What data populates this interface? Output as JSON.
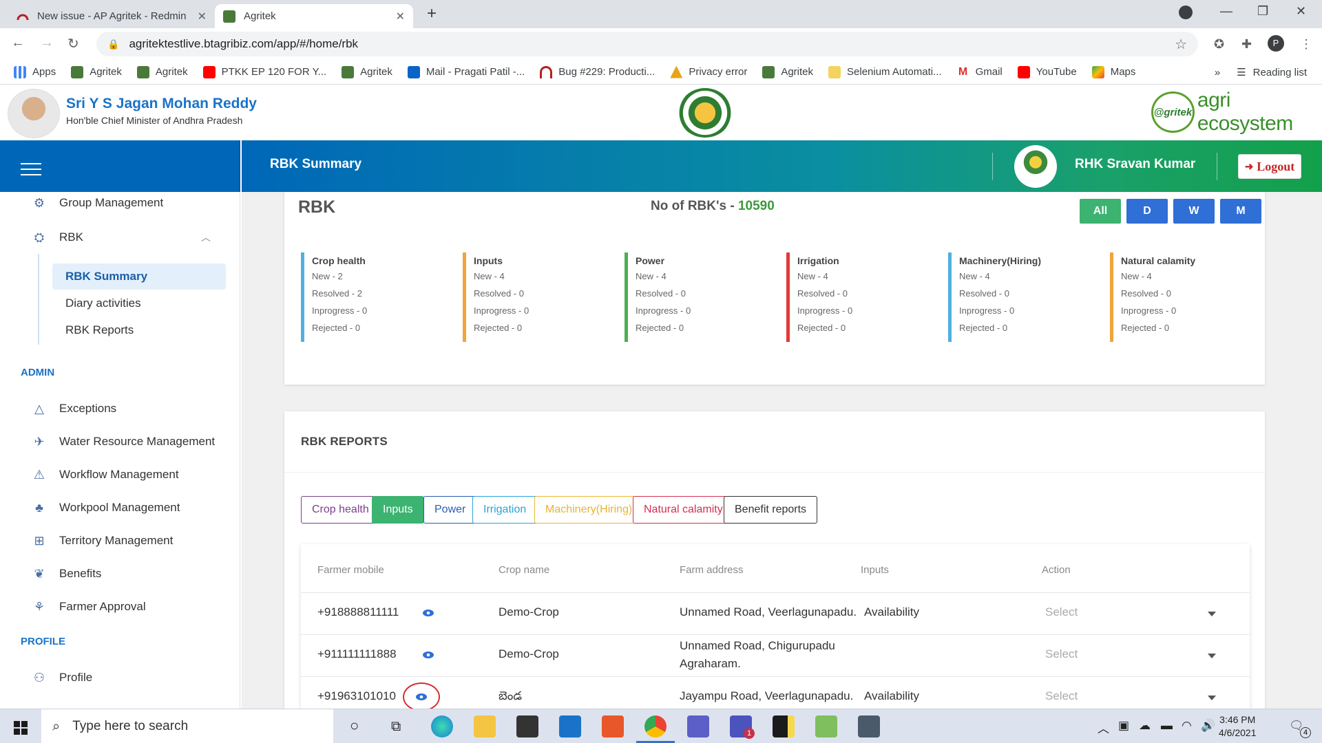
{
  "browser": {
    "tabs": [
      {
        "title": "New issue - AP Agritek - Redmin",
        "active": false
      },
      {
        "title": "Agritek",
        "active": true
      }
    ],
    "url": "agritektestlive.btagribiz.com/app/#/home/rbk",
    "profile_initial": "P",
    "bookmarks": [
      {
        "label": "Apps",
        "icon": "apps-grid-icon",
        "color": "#4285f4"
      },
      {
        "label": "Agritek",
        "icon": "agritek-icon",
        "color": "#4a7a3a"
      },
      {
        "label": "Agritek",
        "icon": "agritek-icon",
        "color": "#4a7a3a"
      },
      {
        "label": "PTKK EP 120 FOR Y...",
        "icon": "youtube-icon",
        "color": "#ff0000"
      },
      {
        "label": "Agritek",
        "icon": "agritek-icon",
        "color": "#4a7a3a"
      },
      {
        "label": "Mail - Pragati Patil -...",
        "icon": "outlook-icon",
        "color": "#0a64c8"
      },
      {
        "label": "Bug #229: Producti...",
        "icon": "redmine-icon",
        "color": "#b32020"
      },
      {
        "label": "Privacy error",
        "icon": "warning-icon",
        "color": "#e8a317"
      },
      {
        "label": "Agritek",
        "icon": "agritek-icon",
        "color": "#4a7a3a"
      },
      {
        "label": "Selenium Automati...",
        "icon": "folder-icon",
        "color": "#f4d35e"
      },
      {
        "label": "Gmail",
        "icon": "gmail-icon",
        "color": "#d93025"
      },
      {
        "label": "YouTube",
        "icon": "youtube-icon",
        "color": "#ff0000"
      },
      {
        "label": "Maps",
        "icon": "maps-icon",
        "color": "#34a853"
      }
    ],
    "more_label": "»",
    "reading_list": "Reading list"
  },
  "header": {
    "cm_name": "Sri Y S Jagan Mohan Reddy",
    "cm_title": "Hon'ble Chief Minister of Andhra Pradesh",
    "logo_badge": "@gritek",
    "logo_text": "agri ecosystem"
  },
  "topnav": {
    "title": "RBK Summary",
    "user_name": "RHK Sravan Kumar",
    "logout_label": "Logout"
  },
  "sidebar": {
    "items": [
      {
        "label": "Group Management",
        "icon": "group-icon"
      },
      {
        "label": "RBK",
        "icon": "rbk-icon"
      }
    ],
    "rbk_sub": [
      "RBK Summary",
      "Diary activities",
      "RBK Reports"
    ],
    "admin_label": "ADMIN",
    "admin_items": [
      {
        "label": "Exceptions",
        "icon": "exceptions-icon"
      },
      {
        "label": "Water Resource Management",
        "icon": "water-icon"
      },
      {
        "label": "Workflow Management",
        "icon": "workflow-icon"
      },
      {
        "label": "Workpool Management",
        "icon": "workpool-icon"
      },
      {
        "label": "Territory Management",
        "icon": "territory-icon"
      },
      {
        "label": "Benefits",
        "icon": "benefits-icon"
      },
      {
        "label": "Farmer Approval",
        "icon": "farmer-approval-icon"
      }
    ],
    "profile_label": "PROFILE",
    "profile_item": {
      "label": "Profile",
      "icon": "profile-icon"
    }
  },
  "summary": {
    "title": "RBK",
    "count_label": "No of RBK's - ",
    "count_value": "10590",
    "periods": [
      "All",
      "D",
      "W",
      "M"
    ],
    "categories": [
      {
        "title": "Crop health",
        "color": "#4fb0e0",
        "lines": [
          "New - 2",
          "Resolved - 2",
          "Inprogress - 0",
          "Rejected - 0"
        ]
      },
      {
        "title": "Inputs",
        "color": "#f0a43a",
        "lines": [
          "New - 4",
          "Resolved - 0",
          "Inprogress - 0",
          "Rejected - 0"
        ]
      },
      {
        "title": "Power",
        "color": "#4caf50",
        "lines": [
          "New - 4",
          "Resolved - 0",
          "Inprogress - 0",
          "Rejected - 0"
        ]
      },
      {
        "title": "Irrigation",
        "color": "#e53935",
        "lines": [
          "New - 4",
          "Resolved - 0",
          "Inprogress - 0",
          "Rejected - 0"
        ]
      },
      {
        "title": "Machinery(Hiring)",
        "color": "#4fb0e0",
        "lines": [
          "New - 4",
          "Resolved - 0",
          "Inprogress - 0",
          "Rejected - 0"
        ]
      },
      {
        "title": "Natural calamity",
        "color": "#f0a43a",
        "lines": [
          "New - 4",
          "Resolved - 0",
          "Inprogress - 0",
          "Rejected - 0"
        ]
      }
    ]
  },
  "reports": {
    "title": "RBK REPORTS",
    "tabs": [
      {
        "label": "Crop health",
        "color": "#7b3f8c",
        "active": false
      },
      {
        "label": "Inputs",
        "color": "#3cb371",
        "active": true
      },
      {
        "label": "Power",
        "color": "#2a5db0",
        "active": false
      },
      {
        "label": "Irrigation",
        "color": "#29a3d9",
        "active": false
      },
      {
        "label": "Machinery(Hiring)",
        "color": "#e9b430",
        "active": false
      },
      {
        "label": "Natural calamity",
        "color": "#d32f4f",
        "active": false
      },
      {
        "label": "Benefit reports",
        "color": "#333333",
        "active": false
      }
    ],
    "columns": [
      "Farmer mobile",
      "Crop name",
      "Farm address",
      "Inputs",
      "Action"
    ],
    "rows": [
      {
        "mobile": "+918888811111",
        "crop": "Demo-Crop",
        "address": "Unnamed Road, Veerlagunapadu.",
        "address2": "",
        "inputs": "Availability",
        "action": "Select"
      },
      {
        "mobile": "+911111111888",
        "crop": "Demo-Crop",
        "address": "Unnamed Road, Chigurupadu",
        "address2": "Agraharam.",
        "inputs": "",
        "action": "Select"
      },
      {
        "mobile": "+91963101010",
        "crop": "బెండ",
        "address": "Jayampu Road, Veerlagunapadu.",
        "address2": "",
        "inputs": "Availability",
        "action": "Select"
      }
    ]
  },
  "taskbar": {
    "search_placeholder": "Type here to search",
    "time": "3:46 PM",
    "date": "4/6/2021",
    "notification_count": "4",
    "teams_badge": "1"
  }
}
